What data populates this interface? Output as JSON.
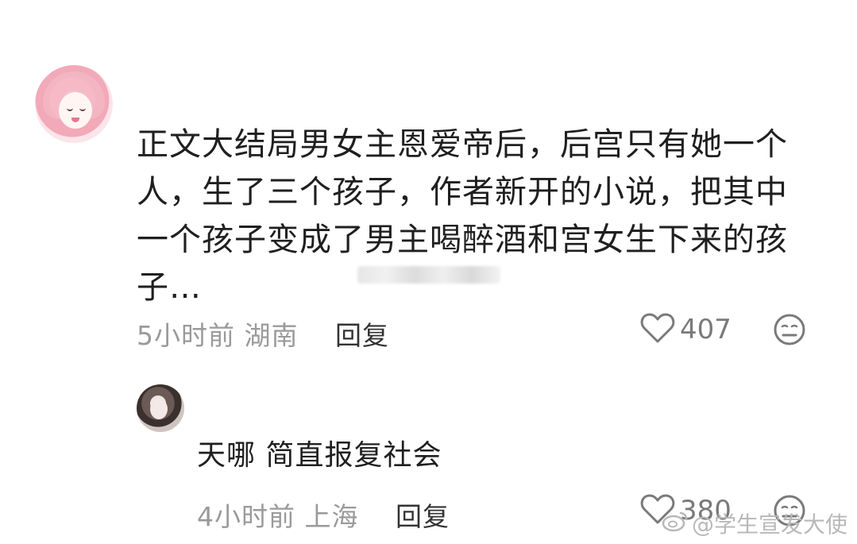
{
  "main_comment": {
    "text": "正文大结局男女主恩爱帝后，后宫只有她一个人，生了三个孩子，作者新开的小说，把其中一个孩子变成了男主喝醉酒和宫女生下来的孩子…",
    "time_location": "5小时前 湖南",
    "reply_label": "回复",
    "likes": "407",
    "avatar_icon": "anime-girl-avatar",
    "like_icon": "heart-outline-icon",
    "dislike_icon": "meh-face-icon"
  },
  "reply_comment": {
    "text": "天哪 简直报复社会",
    "time_location": "4小时前 上海",
    "reply_label": "回复",
    "likes": "380",
    "avatar_icon": "girl-photo-avatar"
  },
  "watermark": {
    "text": "@学生宣发大使",
    "icon": "weibo-icon"
  }
}
